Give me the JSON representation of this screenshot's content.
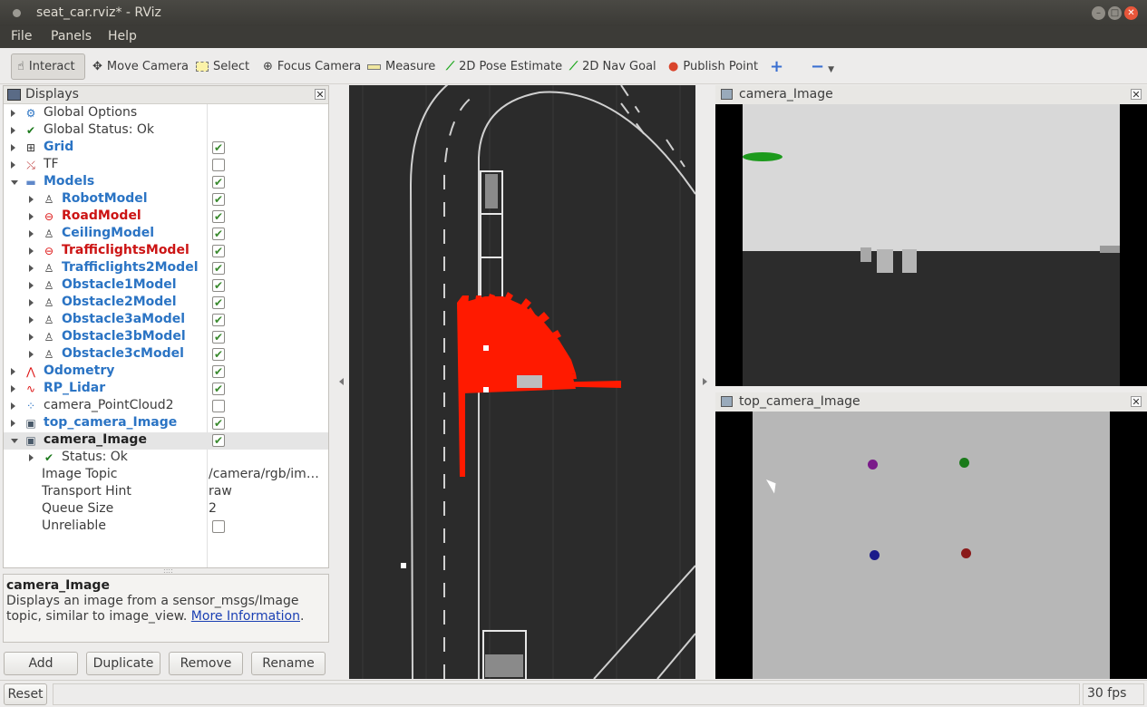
{
  "window": {
    "title": "seat_car.rviz* - RViz"
  },
  "menu": {
    "file": "File",
    "panels": "Panels",
    "help": "Help"
  },
  "toolbar": {
    "interact": "Interact",
    "move_camera": "Move Camera",
    "select": "Select",
    "focus_camera": "Focus Camera",
    "measure": "Measure",
    "pose_estimate": "2D Pose Estimate",
    "nav_goal": "2D Nav Goal",
    "publish_point": "Publish Point"
  },
  "displays": {
    "title": "Displays",
    "rows": [
      {
        "label": "Global Options",
        "icon": "gear-icon",
        "checked": null
      },
      {
        "label": "Global Status: Ok",
        "icon": "check-icon",
        "checked": null
      },
      {
        "label": "Grid",
        "icon": "grid-icon",
        "checked": true
      },
      {
        "label": "TF",
        "icon": "tf-icon",
        "checked": false
      },
      {
        "label": "Models",
        "icon": "folder-icon",
        "checked": true
      },
      {
        "label": "RobotModel",
        "icon": "robot-icon",
        "checked": true
      },
      {
        "label": "RoadModel",
        "icon": "error-icon",
        "checked": true
      },
      {
        "label": "CeilingModel",
        "icon": "robot-icon",
        "checked": true
      },
      {
        "label": "TrafficlightsModel",
        "icon": "error-icon",
        "checked": true
      },
      {
        "label": "Trafficlights2Model",
        "icon": "robot-icon",
        "checked": true
      },
      {
        "label": "Obstacle1Model",
        "icon": "robot-icon",
        "checked": true
      },
      {
        "label": "Obstacle2Model",
        "icon": "robot-icon",
        "checked": true
      },
      {
        "label": "Obstacle3aModel",
        "icon": "robot-icon",
        "checked": true
      },
      {
        "label": "Obstacle3bModel",
        "icon": "robot-icon",
        "checked": true
      },
      {
        "label": "Obstacle3cModel",
        "icon": "robot-icon",
        "checked": true
      },
      {
        "label": "Odometry",
        "icon": "odometry-icon",
        "checked": true
      },
      {
        "label": "RP_Lidar",
        "icon": "laser-icon",
        "checked": true
      },
      {
        "label": "camera_PointCloud2",
        "icon": "pointcloud-icon",
        "checked": false
      },
      {
        "label": "top_camera_Image",
        "icon": "image-icon",
        "checked": true
      },
      {
        "label": "camera_Image",
        "icon": "image-icon",
        "checked": true
      },
      {
        "label": "Status: Ok",
        "icon": "check-icon",
        "checked": null
      }
    ],
    "props": [
      {
        "name": "Image Topic",
        "value": "/camera/rgb/im…"
      },
      {
        "name": "Transport Hint",
        "value": "raw"
      },
      {
        "name": "Queue Size",
        "value": "2"
      },
      {
        "name": "Unreliable",
        "value": ""
      }
    ]
  },
  "description": {
    "title": "camera_Image",
    "text": "Displays an image from a sensor_msgs/Image topic, similar to image_view.",
    "link": "More Information",
    "suffix": "."
  },
  "buttons": {
    "add": "Add",
    "duplicate": "Duplicate",
    "remove": "Remove",
    "rename": "Rename"
  },
  "panels": {
    "camera": "camera_Image",
    "top_camera": "top_camera_Image"
  },
  "status": {
    "reset": "Reset",
    "fps": "30 fps"
  },
  "colors": {
    "bg_dark": "#2b2b2b",
    "laser": "#ff1a00",
    "blue_label": "#2b74c4",
    "error_label": "#cc1414"
  }
}
